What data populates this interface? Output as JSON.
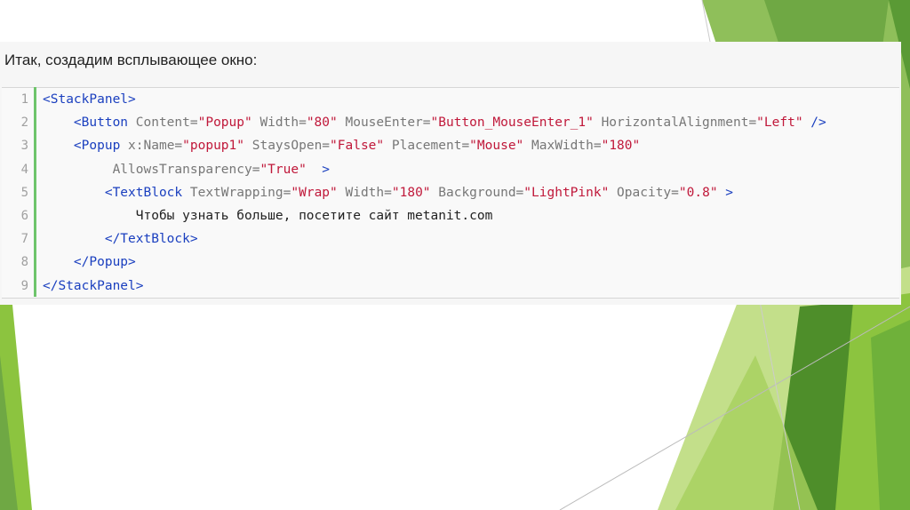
{
  "intro": "Итак, создадим всплывающее окно:",
  "colors": {
    "accent_green": "#6ec46b",
    "tag": "#1a3fbf",
    "attr": "#777777",
    "value": "#c0183a"
  },
  "code": {
    "line_numbers": [
      "1",
      "2",
      "3",
      "4",
      "5",
      "6",
      "7",
      "8",
      "9"
    ],
    "lines": [
      [
        {
          "t": "tag",
          "s": "<StackPanel>"
        }
      ],
      [
        {
          "t": "plain",
          "s": "    "
        },
        {
          "t": "tag",
          "s": "<Button"
        },
        {
          "t": "attr",
          "s": " Content="
        },
        {
          "t": "val",
          "s": "\"Popup\""
        },
        {
          "t": "attr",
          "s": " Width="
        },
        {
          "t": "val",
          "s": "\"80\""
        },
        {
          "t": "attr",
          "s": " MouseEnter="
        },
        {
          "t": "val",
          "s": "\"Button_MouseEnter_1\""
        },
        {
          "t": "attr",
          "s": " HorizontalAlignment="
        },
        {
          "t": "val",
          "s": "\"Left\""
        },
        {
          "t": "tag",
          "s": " />"
        }
      ],
      [
        {
          "t": "plain",
          "s": "    "
        },
        {
          "t": "tag",
          "s": "<Popup"
        },
        {
          "t": "attr",
          "s": " x:Name="
        },
        {
          "t": "val",
          "s": "\"popup1\""
        },
        {
          "t": "attr",
          "s": " StaysOpen="
        },
        {
          "t": "val",
          "s": "\"False\""
        },
        {
          "t": "attr",
          "s": " Placement="
        },
        {
          "t": "val",
          "s": "\"Mouse\""
        },
        {
          "t": "attr",
          "s": " MaxWidth="
        },
        {
          "t": "val",
          "s": "\"180\""
        }
      ],
      [
        {
          "t": "plain",
          "s": "         "
        },
        {
          "t": "attr",
          "s": "AllowsTransparency="
        },
        {
          "t": "val",
          "s": "\"True\""
        },
        {
          "t": "tag",
          "s": "  >"
        }
      ],
      [
        {
          "t": "plain",
          "s": "        "
        },
        {
          "t": "tag",
          "s": "<TextBlock"
        },
        {
          "t": "attr",
          "s": " TextWrapping="
        },
        {
          "t": "val",
          "s": "\"Wrap\""
        },
        {
          "t": "attr",
          "s": " Width="
        },
        {
          "t": "val",
          "s": "\"180\""
        },
        {
          "t": "attr",
          "s": " Background="
        },
        {
          "t": "val",
          "s": "\"LightPink\""
        },
        {
          "t": "attr",
          "s": " Opacity="
        },
        {
          "t": "val",
          "s": "\"0.8\""
        },
        {
          "t": "tag",
          "s": " >"
        }
      ],
      [
        {
          "t": "plain",
          "s": "            Чтобы узнать больше, посетите сайт metanit.com"
        }
      ],
      [
        {
          "t": "plain",
          "s": "        "
        },
        {
          "t": "tag",
          "s": "</TextBlock>"
        }
      ],
      [
        {
          "t": "plain",
          "s": "    "
        },
        {
          "t": "tag",
          "s": "</Popup>"
        }
      ],
      [
        {
          "t": "tag",
          "s": "</StackPanel>"
        }
      ]
    ]
  }
}
